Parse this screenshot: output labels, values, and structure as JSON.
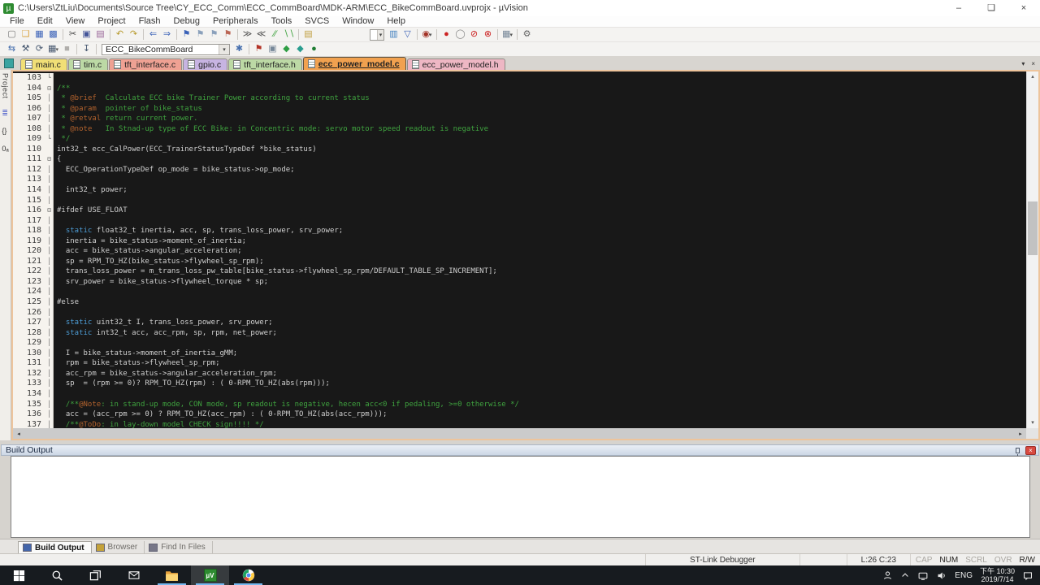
{
  "titlebar": {
    "title": "C:\\Users\\ZtLiu\\Documents\\Source Tree\\CY_ECC_Comm\\ECC_CommBoard\\MDK-ARM\\ECC_BikeCommBoard.uvprojx - µVision",
    "app_icon_glyph": "µ",
    "minimize": "–",
    "maximize": "❏",
    "close": "×",
    "accent_green": "#2e8b31"
  },
  "menubar": [
    "File",
    "Edit",
    "View",
    "Project",
    "Flash",
    "Debug",
    "Peripherals",
    "Tools",
    "SVCS",
    "Window",
    "Help"
  ],
  "toolbar1": [
    {
      "n": "new-file-icon",
      "g": "▢",
      "c": "#777777"
    },
    {
      "n": "open-folder-icon",
      "g": "❑",
      "c": "#d9a441"
    },
    {
      "n": "save-icon",
      "g": "▦",
      "c": "#3b62b8"
    },
    {
      "n": "save-all-icon",
      "g": "▩",
      "c": "#3b62b8"
    },
    {
      "s": 1
    },
    {
      "n": "cut-icon",
      "g": "✂",
      "c": "#444444"
    },
    {
      "n": "copy-icon",
      "g": "▣",
      "c": "#445599"
    },
    {
      "n": "paste-icon",
      "g": "▤",
      "c": "#996699"
    },
    {
      "s": 1
    },
    {
      "n": "undo-icon",
      "g": "↶",
      "c": "#b89b2e"
    },
    {
      "n": "redo-icon",
      "g": "↷",
      "c": "#b89b2e"
    },
    {
      "s": 1
    },
    {
      "n": "navigate-back-icon",
      "g": "⇐",
      "c": "#3b62b8"
    },
    {
      "n": "navigate-forward-icon",
      "g": "⇒",
      "c": "#3b62b8"
    },
    {
      "s": 1
    },
    {
      "n": "bookmark-toggle-icon",
      "g": "⚑",
      "c": "#3b62b8"
    },
    {
      "n": "bookmark-prev-icon",
      "g": "⚑",
      "c": "#8aa0bb"
    },
    {
      "n": "bookmark-next-icon",
      "g": "⚑",
      "c": "#8aa0bb"
    },
    {
      "n": "bookmark-clear-all-icon",
      "g": "⚑",
      "c": "#bb6655"
    },
    {
      "s": 1
    },
    {
      "n": "indent-icon",
      "g": "≫",
      "c": "#555555"
    },
    {
      "n": "outdent-icon",
      "g": "≪",
      "c": "#555555"
    },
    {
      "n": "comment-selection-icon",
      "g": "∕∕",
      "c": "#3fa33f"
    },
    {
      "n": "uncomment-selection-icon",
      "g": "∖∖",
      "c": "#3fa33f"
    },
    {
      "s": 1
    },
    {
      "n": "document-notes-icon",
      "g": "▤",
      "c": "#c09f3f"
    },
    {
      "sp": 64
    },
    {
      "combo": {
        "n": "quick-find-combo",
        "value": "",
        "w": 18
      }
    },
    {
      "n": "find-in-files-icon",
      "g": "▥",
      "c": "#3f7fbf"
    },
    {
      "n": "filter-icon",
      "g": "▽",
      "c": "#3b62b8"
    },
    {
      "s": 1
    },
    {
      "n": "find-dropdown-icon",
      "g": "◉",
      "c": "#a33327",
      "dd": 1
    },
    {
      "s": 1
    },
    {
      "n": "breakpoint-insert-icon",
      "g": "●",
      "c": "#cc2222"
    },
    {
      "n": "breakpoint-enable-icon",
      "g": "◯",
      "c": "#888888"
    },
    {
      "n": "breakpoint-disable-all-icon",
      "g": "⊘",
      "c": "#cc2222"
    },
    {
      "n": "breakpoint-kill-all-icon",
      "g": "⊗",
      "c": "#cc2222"
    },
    {
      "s": 1
    },
    {
      "n": "debug-windows-dropdown-icon",
      "g": "▦",
      "c": "#778899",
      "dd": 1
    },
    {
      "s": 1
    },
    {
      "n": "configure-icon",
      "g": "⚙",
      "c": "#666666"
    }
  ],
  "toolbar2": [
    {
      "n": "translate-file-icon",
      "g": "⇆",
      "c": "#466fae"
    },
    {
      "n": "build-icon",
      "g": "⚒",
      "c": "#45566e"
    },
    {
      "n": "rebuild-icon",
      "g": "⟳",
      "c": "#45566e"
    },
    {
      "n": "batch-build-dropdown-icon",
      "g": "▦",
      "c": "#45566e",
      "dd": 1
    },
    {
      "n": "stop-build-icon",
      "g": "■",
      "c": "#b0aeab"
    },
    {
      "s": 1
    },
    {
      "n": "download-icon",
      "g": "↧",
      "c": "#45566e"
    },
    {
      "s": 1
    },
    {
      "combo": {
        "n": "target-select-combo",
        "value": "ECC_BikeCommBoard",
        "w": 158
      }
    },
    {
      "n": "target-options-icon",
      "g": "✱",
      "c": "#466fae"
    },
    {
      "s": 1
    },
    {
      "n": "manage-project-items-icon",
      "g": "⚑",
      "c": "#b33327"
    },
    {
      "n": "multi-project-icon",
      "g": "▣",
      "c": "#778899"
    },
    {
      "n": "manage-rte-icon",
      "g": "◆",
      "c": "#2f9e44"
    },
    {
      "n": "select-packs-icon",
      "g": "◆",
      "c": "#2a9d8f"
    },
    {
      "n": "pack-installer-icon",
      "g": "●",
      "c": "#1e7d32"
    }
  ],
  "ui": {
    "caret": "▾"
  },
  "tabstrip": {
    "dropdown": "▾",
    "close": "×",
    "tabs": [
      {
        "label": "main.c",
        "color": "#f1df76",
        "active": false
      },
      {
        "label": "tim.c",
        "color": "#bcd9a5",
        "active": false
      },
      {
        "label": "tft_interface.c",
        "color": "#efa193",
        "active": false
      },
      {
        "label": "gpio.c",
        "color": "#c7b4e2",
        "active": false
      },
      {
        "label": "tft_interface.h",
        "color": "#bcd9a5",
        "active": false
      },
      {
        "label": "ecc_power_model.c",
        "color": "#f1a14f",
        "active": true
      },
      {
        "label": "ecc_power_model.h",
        "color": "#eeb7c4",
        "active": false
      }
    ]
  },
  "dock": {
    "label": "Project",
    "icons": [
      {
        "name": "books-icon",
        "glyph": "≣",
        "color": "#5566cc"
      },
      {
        "name": "functions-icon",
        "glyph": "{}",
        "color": "#333333"
      },
      {
        "name": "templates-icon",
        "glyph": "0ₐ",
        "color": "#333333"
      }
    ]
  },
  "fold_glyphs": {
    "b": "⊟",
    "l": "│",
    "e": "└"
  },
  "editor": {
    "colors": {
      "background": "#181818",
      "plain": "#cfcfcf",
      "comment": "#3fa33f",
      "doc_tag": "#b2622d",
      "keyword": "#4d9dd6"
    },
    "lines": [
      [
        103,
        "e",
        []
      ],
      [
        104,
        "b",
        [
          [
            "/**",
            "c"
          ]
        ]
      ],
      [
        105,
        "l",
        [
          [
            " * ",
            "c"
          ],
          [
            "@brief",
            "t"
          ],
          [
            "  Calculate ECC bike Trainer Power according to current status",
            "c"
          ]
        ]
      ],
      [
        106,
        "l",
        [
          [
            " * ",
            "c"
          ],
          [
            "@param",
            "t"
          ],
          [
            "  pointer of bike_status",
            "c"
          ]
        ]
      ],
      [
        107,
        "l",
        [
          [
            " * ",
            "c"
          ],
          [
            "@retval",
            "t"
          ],
          [
            " return current power.",
            "c"
          ]
        ]
      ],
      [
        108,
        "l",
        [
          [
            " * ",
            "c"
          ],
          [
            "@note",
            "t"
          ],
          [
            "   In Stnad-up type of ECC Bike: in Concentric mode: servo motor speed readout is negative",
            "c"
          ]
        ]
      ],
      [
        109,
        "e",
        [
          [
            " */",
            "c"
          ]
        ]
      ],
      [
        110,
        "",
        [
          [
            "int32_t ecc_CalPower(ECC_TrainerStatusTypeDef *bike_status)",
            "p"
          ]
        ]
      ],
      [
        111,
        "b",
        [
          [
            "{",
            "p"
          ]
        ]
      ],
      [
        112,
        "l",
        [
          [
            "  ECC_OperationTypeDef op_mode = bike_status->op_mode;",
            "p"
          ]
        ]
      ],
      [
        113,
        "l",
        []
      ],
      [
        114,
        "l",
        [
          [
            "  int32_t power;",
            "p"
          ]
        ]
      ],
      [
        115,
        "l",
        []
      ],
      [
        116,
        "b",
        [
          [
            "#ifdef USE_FLOAT",
            "p"
          ]
        ]
      ],
      [
        117,
        "l",
        []
      ],
      [
        118,
        "l",
        [
          [
            "  ",
            "p"
          ],
          [
            "static",
            "k"
          ],
          [
            " float32_t inertia, acc, sp, trans_loss_power, srv_power;",
            "p"
          ]
        ]
      ],
      [
        119,
        "l",
        [
          [
            "  inertia = bike_status->moment_of_inertia;",
            "p"
          ]
        ]
      ],
      [
        120,
        "l",
        [
          [
            "  acc = bike_status->angular_acceleration;",
            "p"
          ]
        ]
      ],
      [
        121,
        "l",
        [
          [
            "  sp = RPM_TO_HZ(bike_status->flywheel_sp_rpm);",
            "p"
          ]
        ]
      ],
      [
        122,
        "l",
        [
          [
            "  trans_loss_power = m_trans_loss_pw_table[bike_status->flywheel_sp_rpm/DEFAULT_TABLE_SP_INCREMENT];",
            "p"
          ]
        ]
      ],
      [
        123,
        "l",
        [
          [
            "  srv_power = bike_status->flywheel_torque * sp;",
            "p"
          ]
        ]
      ],
      [
        124,
        "l",
        []
      ],
      [
        125,
        "l",
        [
          [
            "#else",
            "p"
          ]
        ]
      ],
      [
        126,
        "l",
        []
      ],
      [
        127,
        "l",
        [
          [
            "  ",
            "p"
          ],
          [
            "static",
            "k"
          ],
          [
            " uint32_t I, trans_loss_power, srv_power;",
            "p"
          ]
        ]
      ],
      [
        128,
        "l",
        [
          [
            "  ",
            "p"
          ],
          [
            "static",
            "k"
          ],
          [
            " int32_t acc, acc_rpm, sp, rpm, net_power;",
            "p"
          ]
        ]
      ],
      [
        129,
        "l",
        []
      ],
      [
        130,
        "l",
        [
          [
            "  I = bike_status->moment_of_inertia_gMM;",
            "p"
          ]
        ]
      ],
      [
        131,
        "l",
        [
          [
            "  rpm = bike_status->flywheel_sp_rpm;",
            "p"
          ]
        ]
      ],
      [
        132,
        "l",
        [
          [
            "  acc_rpm = bike_status->angular_acceleration_rpm;",
            "p"
          ]
        ]
      ],
      [
        133,
        "l",
        [
          [
            "  sp  = (rpm >= 0)? RPM_TO_HZ(rpm) : ( 0-RPM_TO_HZ(abs(rpm)));",
            "p"
          ]
        ]
      ],
      [
        134,
        "l",
        []
      ],
      [
        135,
        "l",
        [
          [
            "  /**",
            "c"
          ],
          [
            "@Note",
            "t"
          ],
          [
            ": in stand-up mode, CON mode, sp readout is negative, hecen acc<0 if pedaling, >=0 otherwise */",
            "c"
          ]
        ]
      ],
      [
        136,
        "l",
        [
          [
            "  acc = (acc_rpm >= 0) ? RPM_TO_HZ(acc_rpm) : ( 0-RPM_TO_HZ(abs(acc_rpm)));",
            "p"
          ]
        ]
      ],
      [
        137,
        "l",
        [
          [
            "  /**",
            "c"
          ],
          [
            "@ToDo",
            "t"
          ],
          [
            ": in lay-down model CHECK sign!!!! */",
            "c"
          ]
        ]
      ]
    ],
    "scroll": {
      "up_arrow": "▴",
      "down_arrow": "▾",
      "left_arrow": "◂",
      "right_arrow": "▸"
    }
  },
  "build_output": {
    "title": "Build Output",
    "close": "×",
    "content": ""
  },
  "bottom_tabs": [
    {
      "label": "Build Output",
      "icon": "build-output-icon",
      "color": "#4466aa",
      "active": true
    },
    {
      "label": "Browser",
      "icon": "browser-icon",
      "color": "#c4a23a",
      "active": false
    },
    {
      "label": "Find In Files",
      "icon": "find-in-files-icon",
      "color": "#777788",
      "active": false
    }
  ],
  "statusbar": {
    "debugger": "ST-Link Debugger",
    "cursor": "L:26 C:23",
    "flags": [
      [
        "CAP",
        0
      ],
      [
        "NUM",
        1
      ],
      [
        "SCRL",
        0
      ],
      [
        "OVR",
        0
      ],
      [
        "R/W",
        1
      ]
    ]
  },
  "taskbar": {
    "icons": [
      {
        "name": "start-button",
        "underline": false,
        "active": false
      },
      {
        "name": "search-icon",
        "underline": false,
        "active": false
      },
      {
        "name": "task-view-icon",
        "underline": false,
        "active": false
      },
      {
        "name": "mail-icon",
        "underline": false,
        "active": false
      },
      {
        "name": "file-explorer-icon",
        "underline": true,
        "active": false
      },
      {
        "name": "uvision-taskbar-icon",
        "underline": true,
        "active": true
      },
      {
        "name": "chrome-icon",
        "underline": true,
        "active": false
      }
    ],
    "uvision_glyph": "µV",
    "tray": {
      "lang": "ENG",
      "time": "下午 10:30",
      "date": "2019/7/14"
    }
  }
}
